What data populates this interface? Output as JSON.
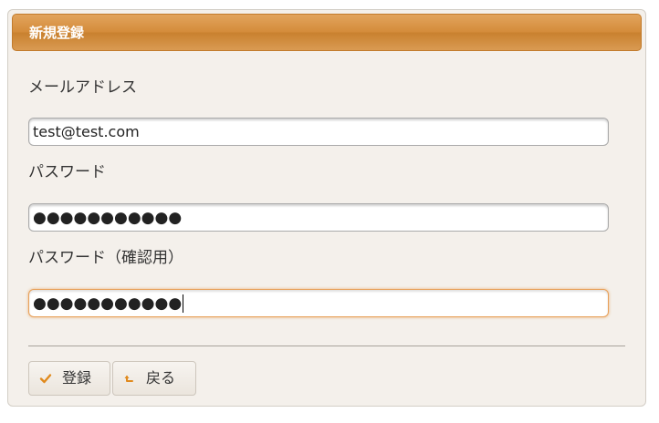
{
  "panel": {
    "title": "新規登録"
  },
  "form": {
    "email": {
      "label": "メールアドレス",
      "value": "test@test.com"
    },
    "password": {
      "label": "パスワード",
      "masked_value": "●●●●●●●●●●●"
    },
    "password_confirm": {
      "label": "パスワード（確認用）",
      "masked_value": "●●●●●●●●●●●"
    }
  },
  "buttons": {
    "register_label": "登録",
    "back_label": "戻る"
  },
  "colors": {
    "accent": "#d48c3b",
    "focus_border": "#e8a15a",
    "panel_bg": "#f4f0eb"
  }
}
